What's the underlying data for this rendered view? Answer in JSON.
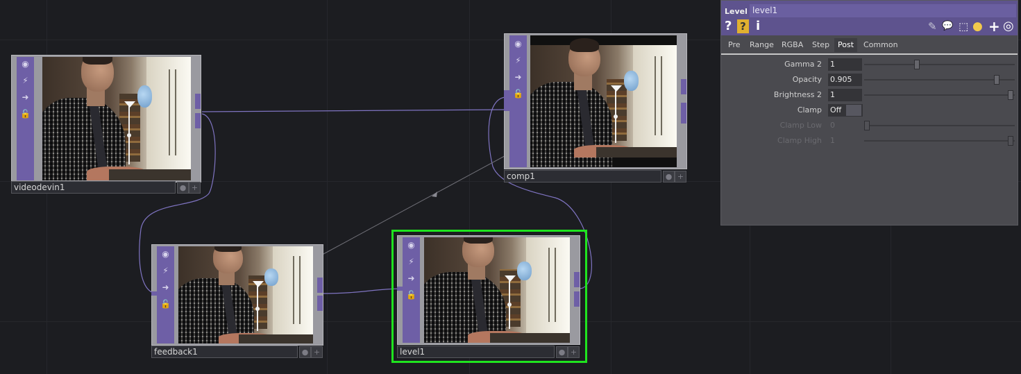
{
  "network": {
    "nodes": [
      {
        "id": "videodevin1",
        "label": "videodevin1"
      },
      {
        "id": "comp1",
        "label": "comp1"
      },
      {
        "id": "feedback1",
        "label": "feedback1"
      },
      {
        "id": "level1",
        "label": "level1",
        "selected": true
      }
    ],
    "node_icons": [
      "viewer-icon",
      "bypass-icon",
      "output-icon",
      "lock-icon"
    ],
    "colors": {
      "background": "#1c1d21",
      "operator": "#6e5fa6",
      "wire": "#7f74c2",
      "selection": "#1fe41f"
    }
  },
  "panel": {
    "type_label": "Level",
    "name": "level1",
    "icons": [
      "help-icon",
      "operator-help-icon",
      "info-icon",
      "edit-icon",
      "comment-icon",
      "clone-icon",
      "python-icon",
      "add-icon",
      "target-icon"
    ],
    "icon_glyphs": {
      "help": "?",
      "op_help": "?",
      "info": "i",
      "edit": "✎",
      "comment": "💬",
      "clone": "⬚",
      "python": "●",
      "add": "+",
      "target": "◎"
    },
    "tabs": [
      "Pre",
      "Range",
      "RGBA",
      "Step",
      "Post",
      "Common"
    ],
    "active_tab": "Post",
    "params": {
      "gamma2": {
        "label": "Gamma 2",
        "value": "1",
        "slider": 0.35
      },
      "opacity": {
        "label": "Opacity",
        "value": "0.905",
        "slider": 0.905
      },
      "brightness2": {
        "label": "Brightness 2",
        "value": "1",
        "slider": 1.0
      },
      "clamp": {
        "label": "Clamp",
        "value": "Off"
      },
      "clamp_low": {
        "label": "Clamp Low",
        "value": "0",
        "slider": 0.0,
        "disabled": true
      },
      "clamp_high": {
        "label": "Clamp High",
        "value": "1",
        "slider": 1.0,
        "disabled": true
      }
    }
  }
}
